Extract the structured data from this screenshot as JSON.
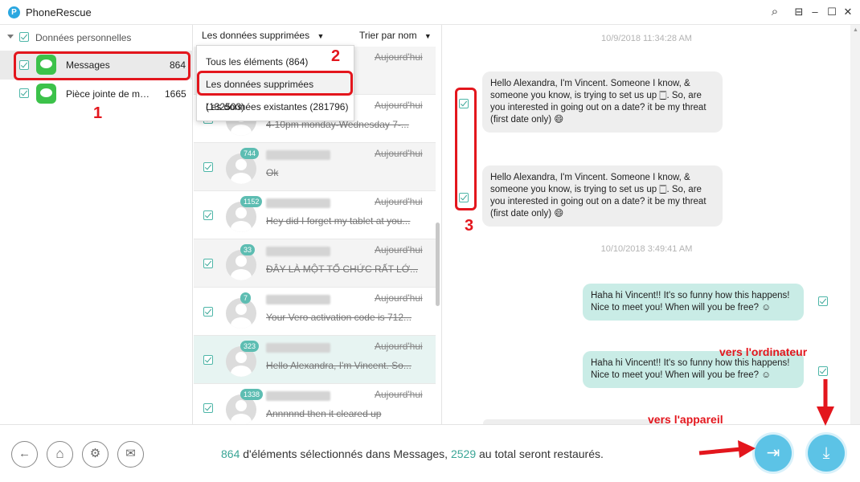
{
  "app": {
    "logo": "P",
    "title": "PhoneRescue"
  },
  "window_icons": {
    "search": "⌕",
    "menu": "⊟",
    "minimize": "–",
    "maximize": "☐",
    "close": "✕"
  },
  "sidebar": {
    "group_label": "Données personnelles",
    "items": [
      {
        "label": "Messages",
        "count": "864"
      },
      {
        "label": "Pièce jointe de m…",
        "count": "1665"
      }
    ]
  },
  "list_header": {
    "filter": "Les données supprimées",
    "sort": "Trier par nom"
  },
  "dropdown": {
    "options": [
      "Tous les éléments (864)",
      "Les données supprimées (132503)",
      "Les données existantes (281796)"
    ]
  },
  "rows": [
    {
      "badge": "",
      "date": "Aujourd'hui",
      "snippet": "…ns"
    },
    {
      "badge": "",
      "date": "Aujourd'hui",
      "snippet": "4-10pm monday-Wednesday 7-..."
    },
    {
      "badge": "744",
      "date": "Aujourd'hui",
      "snippet": "Ok"
    },
    {
      "badge": "1152",
      "date": "Aujourd'hui",
      "snippet": "Hey did I forget my tablet at you..."
    },
    {
      "badge": "33",
      "date": "Aujourd'hui",
      "snippet": "ĐÂY LÀ MỘT TỔ CHỨC RẤT LỚ..."
    },
    {
      "badge": "7",
      "date": "Aujourd'hui",
      "snippet": "Your Vero activation code is 712..."
    },
    {
      "badge": "323",
      "date": "Aujourd'hui",
      "snippet": "Hello Alexandra, I'm Vincent. So..."
    },
    {
      "badge": "1338",
      "date": "Aujourd'hui",
      "snippet": "Annnnnd then it cleared up"
    }
  ],
  "chat": {
    "stamp1": "10/9/2018 11:34:28 AM",
    "stamp2": "10/10/2018 3:49:41 AM",
    "incoming": [
      "Hello Alexandra, I'm Vincent. Someone I know, & someone you know, is trying to set us up 🀆. So, are you interested in going out on a date? it be my threat (first date only) 😄",
      "Hello Alexandra, I'm Vincent. Someone I know, & someone you know, is trying to set us up 🀆. So, are you interested in going out on a date? it be my threat (first date only) 😄"
    ],
    "outgoing": [
      "Haha hi Vincent!! It's so funny how this happens! Nice to meet you! When will you be free? ☺",
      "Haha hi Vincent!! It's so funny how this happens! Nice to meet you! When will you be free? ☺"
    ]
  },
  "annotations": {
    "n1": "1",
    "n2": "2",
    "n3": "3",
    "to_computer": "vers l'ordinateur",
    "to_device": "vers l'appareil"
  },
  "status": {
    "count": "864",
    "mid": " d'éléments sélectionnés dans Messages, ",
    "total": "2529",
    "end": " au total seront restaurés."
  },
  "nav_icons": {
    "back": "←",
    "home": "⌂",
    "settings": "⚙",
    "mail": "✉",
    "to_device": "⇥",
    "to_computer": "⤓"
  },
  "colors": {
    "accent": "#3aa596",
    "annotation": "#e3161d",
    "restore_button": "#5cc3e6"
  }
}
